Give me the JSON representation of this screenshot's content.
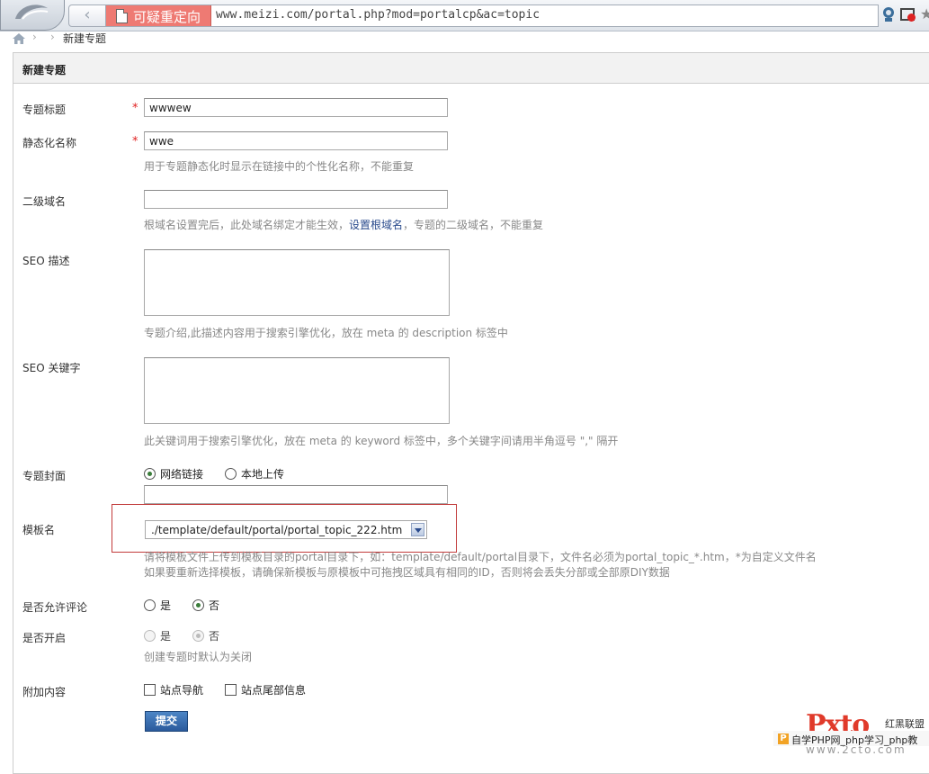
{
  "browser": {
    "warning_label": "可疑重定向",
    "url": "www.meizi.com/portal.php?mod=portalcp&ac=topic",
    "back_glyph": "‹",
    "star_glyph": "★"
  },
  "breadcrumb": {
    "home_icon": "home-icon",
    "separator": "›",
    "current": "新建专题"
  },
  "panel": {
    "title": "新建专题"
  },
  "form": {
    "required_mark": "*",
    "title": {
      "label": "专题标题",
      "value": "wwwew"
    },
    "static_name": {
      "label": "静态化名称",
      "value": "wwe",
      "hint": "用于专题静态化时显示在链接中的个性化名称，不能重复"
    },
    "subdomain": {
      "label": "二级域名",
      "value": "",
      "hint_before": "根域名设置完后，此处域名绑定才能生效，",
      "hint_link": "设置根域名",
      "hint_after": "，专题的二级域名，不能重复"
    },
    "seo_desc": {
      "label": "SEO 描述",
      "hint": "专题介绍,此描述内容用于搜索引擎优化，放在 meta 的 description 标签中"
    },
    "seo_keywords": {
      "label": "SEO 关键字",
      "hint": "此关键词用于搜索引擎优化，放在 meta 的 keyword 标签中，多个关键字间请用半角逗号 \",\" 隔开"
    },
    "cover": {
      "label": "专题封面",
      "option_url": "网络链接",
      "option_upload": "本地上传",
      "selected": "网络链接",
      "value": ""
    },
    "template": {
      "label": "模板名",
      "selected": "./template/default/portal/portal_topic_222.htm",
      "hint_line1": "请将模板文件上传到模板目录的portal目录下，如：template/default/portal目录下，文件名必须为portal_topic_*.htm，*为自定义文件名",
      "hint_line2": "如果要重新选择模板，请确保新模板与原模板中可拖拽区域具有相同的ID，否则将会丢失分部或全部原DIY数据"
    },
    "allow_comment": {
      "label": "是否允许评论",
      "yes": "是",
      "no": "否",
      "selected": "否"
    },
    "enabled": {
      "label": "是否开启",
      "yes": "是",
      "no": "否",
      "selected": "否",
      "hint": "创建专题时默认为关闭"
    },
    "extras": {
      "label": "附加内容",
      "option_nav": "站点导航",
      "option_footer": "站点尾部信息"
    },
    "submit_label": "提交"
  },
  "watermark": {
    "logo": "Pxto",
    "subtitle": "红黑联盟",
    "bar_icon": "P",
    "bar_text": "自学PHP网_php学习_php教",
    "underlay": "www.2cto.com"
  },
  "colors": {
    "warning_bg": "#ee7a73",
    "required": "#e02020",
    "link": "#2a4b8d",
    "submit_bg": "#2b5a9c",
    "highlight_border": "#c23b3b"
  }
}
